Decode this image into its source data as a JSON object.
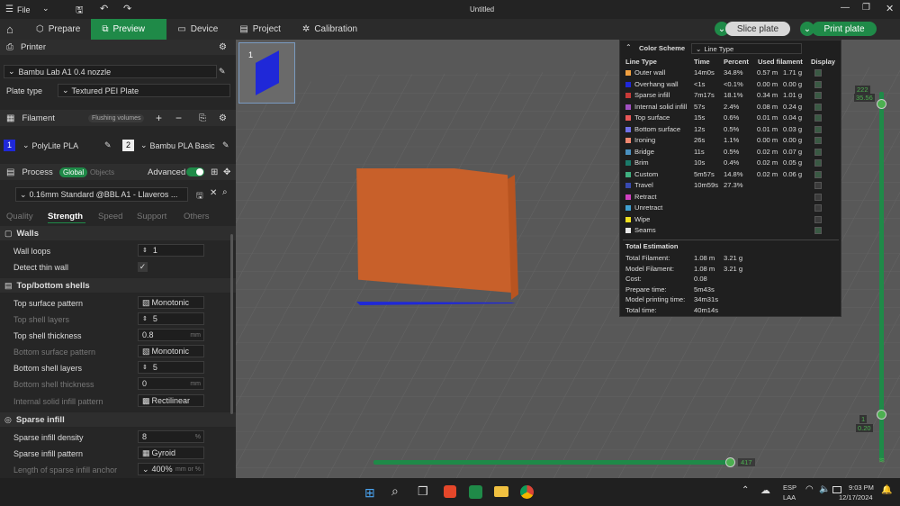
{
  "titlebar": {
    "file": "File",
    "title": "Untitled"
  },
  "nav": {
    "tabs": [
      "Prepare",
      "Preview",
      "Device",
      "Project",
      "Calibration"
    ],
    "slice": "Slice plate",
    "print": "Print plate"
  },
  "printer": {
    "header": "Printer",
    "name": "Bambu Lab A1 0.4 nozzle",
    "plate_label": "Plate type",
    "plate_value": "Textured PEI Plate"
  },
  "filament": {
    "header": "Filament",
    "flushing": "Flushing volumes",
    "f1_num": "1",
    "f1": "PolyLite PLA",
    "f2_num": "2",
    "f2": "Bambu PLA Basic"
  },
  "process": {
    "header": "Process",
    "global": "Global",
    "objects": "Objects",
    "advanced": "Advanced",
    "preset": "0.16mm Standard @BBL A1 - Llaveros ...",
    "tabs": [
      "Quality",
      "Strength",
      "Speed",
      "Support",
      "Others"
    ]
  },
  "settings": {
    "walls_hdr": "Walls",
    "wall_loops": "Wall loops",
    "wall_loops_v": "1",
    "detect_thin": "Detect thin wall",
    "tb_hdr": "Top/bottom shells",
    "top_pattern": "Top surface pattern",
    "top_pattern_v": "Monotonic",
    "top_layers": "Top shell layers",
    "top_layers_v": "5",
    "top_thick": "Top shell thickness",
    "top_thick_v": "0.8",
    "bot_pattern": "Bottom surface pattern",
    "bot_pattern_v": "Monotonic",
    "bot_layers": "Bottom shell layers",
    "bot_layers_v": "5",
    "bot_thick": "Bottom shell thickness",
    "bot_thick_v": "0",
    "int_pattern": "Internal solid infill pattern",
    "int_pattern_v": "Rectilinear",
    "sparse_hdr": "Sparse infill",
    "density": "Sparse infill density",
    "density_v": "8",
    "pct": "%",
    "sparse_pattern": "Sparse infill pattern",
    "sparse_pattern_v": "Gyroid",
    "anchor": "Length of sparse infill anchor",
    "anchor_v": "400%",
    "anchor_unit": "mm or %",
    "mm": "mm"
  },
  "legend": {
    "scheme_label": "Color Scheme",
    "scheme_value": "Line Type",
    "cols": [
      "Line Type",
      "Time",
      "Percent",
      "Used filament",
      "Display"
    ],
    "rows": [
      {
        "name": "Outer wall",
        "time": "14m0s",
        "pct": "34.8%",
        "len": "0.57 m",
        "g": "1.71 g",
        "color": "#f0a040",
        "on": true
      },
      {
        "name": "Overhang wall",
        "time": "<1s",
        "pct": "<0.1%",
        "len": "0.00 m",
        "g": "0.00 g",
        "color": "#1f28d8",
        "on": true
      },
      {
        "name": "Sparse infill",
        "time": "7m17s",
        "pct": "18.1%",
        "len": "0.34 m",
        "g": "1.01 g",
        "color": "#c83a38",
        "on": true
      },
      {
        "name": "Internal solid infill",
        "time": "57s",
        "pct": "2.4%",
        "len": "0.08 m",
        "g": "0.24 g",
        "color": "#a050c0",
        "on": true
      },
      {
        "name": "Top surface",
        "time": "15s",
        "pct": "0.6%",
        "len": "0.01 m",
        "g": "0.04 g",
        "color": "#e85858",
        "on": true
      },
      {
        "name": "Bottom surface",
        "time": "12s",
        "pct": "0.5%",
        "len": "0.01 m",
        "g": "0.03 g",
        "color": "#7070e8",
        "on": true
      },
      {
        "name": "Ironing",
        "time": "26s",
        "pct": "1.1%",
        "len": "0.00 m",
        "g": "0.00 g",
        "color": "#f08870",
        "on": true
      },
      {
        "name": "Bridge",
        "time": "11s",
        "pct": "0.5%",
        "len": "0.02 m",
        "g": "0.07 g",
        "color": "#4a90c0",
        "on": true
      },
      {
        "name": "Brim",
        "time": "10s",
        "pct": "0.4%",
        "len": "0.02 m",
        "g": "0.05 g",
        "color": "#1a7a6a",
        "on": true
      },
      {
        "name": "Custom",
        "time": "5m57s",
        "pct": "14.8%",
        "len": "0.02 m",
        "g": "0.06 g",
        "color": "#40b080",
        "on": true
      },
      {
        "name": "Travel",
        "time": "10m59s",
        "pct": "27.3%",
        "len": "",
        "g": "",
        "color": "#384ab0",
        "on": false
      },
      {
        "name": "Retract",
        "time": "",
        "pct": "",
        "len": "",
        "g": "",
        "color": "#d040c0",
        "on": false
      },
      {
        "name": "Unretract",
        "time": "",
        "pct": "",
        "len": "",
        "g": "",
        "color": "#40a0d0",
        "on": false
      },
      {
        "name": "Wipe",
        "time": "",
        "pct": "",
        "len": "",
        "g": "",
        "color": "#f0e020",
        "on": false
      },
      {
        "name": "Seams",
        "time": "",
        "pct": "",
        "len": "",
        "g": "",
        "color": "#e8e8e8",
        "on": true
      }
    ],
    "total_hdr": "Total Estimation",
    "totals": [
      {
        "k": "Total Filament:",
        "v": "1.08 m",
        "v2": "3.21 g"
      },
      {
        "k": "Model Filament:",
        "v": "1.08 m",
        "v2": "3.21 g"
      },
      {
        "k": "Cost:",
        "v": "0.08",
        "v2": ""
      },
      {
        "k": "Prepare time:",
        "v": "5m43s",
        "v2": ""
      },
      {
        "k": "Model printing time:",
        "v": "34m31s",
        "v2": ""
      },
      {
        "k": "Total time:",
        "v": "40m14s",
        "v2": ""
      }
    ]
  },
  "viewport": {
    "plate_num": "1",
    "layer_top": "222",
    "layer_top_h": "35.56",
    "layer_bot": "1",
    "layer_bot_h": "0.20",
    "move_count": "417"
  },
  "taskbar": {
    "lang1": "ESP",
    "lang2": "LAA",
    "time": "9:03 PM",
    "date": "12/17/2024"
  }
}
